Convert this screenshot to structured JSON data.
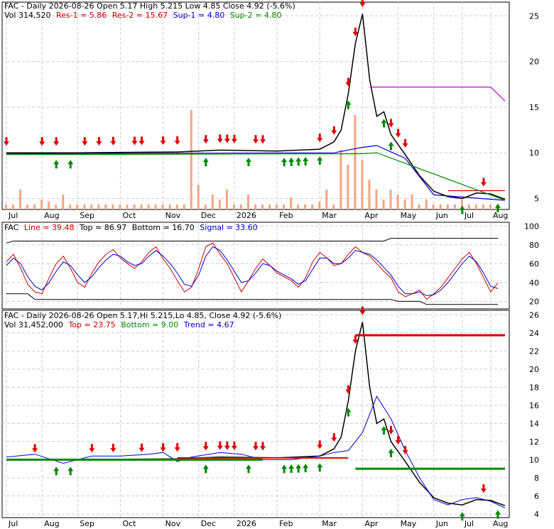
{
  "header": {
    "panel1_line1": "FAC - Daily 2026-08-26 Open 5.17  High 5.215  Low 4.85  Close 4.92 (-5.6%)",
    "panel1_line2_vol": "Vol 314,520",
    "panel1_res1": "Res-1 = 5.86",
    "panel1_res2": "Res-2 = 15.67",
    "panel1_sup1": "Sup-1 = 4.80",
    "panel1_sup2": "Sup-2 = 4.80",
    "panel2_symbol": "FAC",
    "panel2_line": "Line = 39.48",
    "panel2_top": "Top = 86.97",
    "panel2_bottom": "Bottom = 16.70",
    "panel2_signal": "Signal = 33.60",
    "panel3_line1": "FAC - Daily 2026-08-26 Open 5.17,Hi 5.215,Lo 4.85, Close 4.92 (-5.6%)",
    "panel3_line2_vol": "Vol 31,452,000",
    "panel3_top": "Top = 23.75",
    "panel3_bottom": "Bottom = 9.00",
    "panel3_trend": "Trend = 4.67"
  },
  "colors": {
    "res1": "#cc0000",
    "res2": "#cc0000",
    "sup1": "#0000cc",
    "sup2": "#008800",
    "volume": "#f4a582",
    "price": "#000000",
    "ma_blue": "#0000cc",
    "ma_magenta": "#cc00cc",
    "line_red": "#cc0000",
    "signal_blue": "#0000cc",
    "trend_green": "#008800",
    "top_red": "#dd0000",
    "up_arrow": "#008800",
    "down_arrow": "#dd0000"
  },
  "chart_data": [
    {
      "type": "line",
      "panel": "price-with-support-resistance",
      "x_labels": [
        "Jul",
        "Aug",
        "Sep",
        "Oct",
        "Nov",
        "Dec",
        "2026",
        "Feb",
        "Mar",
        "Apr",
        "May",
        "Jun",
        "Jul",
        "Aug"
      ],
      "y_ticks": [
        5,
        10,
        15,
        20,
        25
      ],
      "ylim": [
        3.8,
        26.5
      ],
      "series": [
        {
          "name": "Close",
          "points": [
            [
              0,
              10
            ],
            [
              10,
              10
            ],
            [
              24,
              10.1
            ],
            [
              30,
              10.3
            ],
            [
              38,
              10.2
            ],
            [
              44,
              10.4
            ],
            [
              46,
              11.2
            ],
            [
              47,
              12.5
            ],
            [
              48,
              16.5
            ],
            [
              49,
              22
            ],
            [
              50,
              25.2
            ],
            [
              51,
              18
            ],
            [
              52,
              14
            ],
            [
              53,
              14.5
            ],
            [
              54,
              12
            ],
            [
              56,
              9.8
            ],
            [
              58,
              7.5
            ],
            [
              60,
              5.8
            ],
            [
              62,
              5.2
            ],
            [
              64,
              5.0
            ],
            [
              66,
              5.6
            ],
            [
              68,
              5.5
            ],
            [
              70,
              4.92
            ]
          ]
        },
        {
          "name": "Res-1",
          "points": [
            [
              62,
              5.86
            ],
            [
              70,
              5.86
            ]
          ]
        },
        {
          "name": "Res-2",
          "points": [
            [
              51,
              17.2
            ],
            [
              68,
              17.2
            ],
            [
              70,
              15.67
            ]
          ]
        },
        {
          "name": "Sup-1",
          "points": [
            [
              0,
              9.9
            ],
            [
              46,
              10
            ],
            [
              50,
              10.6
            ],
            [
              52,
              10.8
            ],
            [
              56,
              9.4
            ],
            [
              60,
              5.4
            ],
            [
              70,
              4.8
            ]
          ]
        },
        {
          "name": "Sup-2",
          "points": [
            [
              0,
              9.8
            ],
            [
              50,
              9.9
            ],
            [
              52,
              10
            ],
            [
              70,
              4.8
            ]
          ]
        }
      ],
      "volume": [
        0.05,
        0.05,
        0.2,
        0.05,
        0.05,
        0.1,
        0.08,
        0.05,
        0.15,
        0.05,
        0.05,
        0.05,
        0.05,
        0.05,
        0.05,
        0.05,
        0.05,
        0.05,
        0.05,
        0.05,
        0.05,
        0.05,
        0.05,
        0.05,
        0.05,
        0.05,
        1.0,
        0.25,
        0.05,
        0.15,
        0.1,
        0.2,
        0.05,
        0.05,
        0.15,
        0.05,
        0.05,
        0.05,
        0.05,
        0.05,
        0.12,
        0.05,
        0.05,
        0.05,
        0.08,
        0.2,
        0.05,
        0.6,
        0.45,
        0.95,
        0.5,
        0.3,
        0.2,
        0.1,
        0.2,
        0.15,
        0.1,
        0.15,
        0.05,
        0.1,
        0.05,
        0.05,
        0.05,
        0.05,
        0.1,
        0.05,
        0.05,
        0.05,
        0.05,
        0.05
      ],
      "up_arrows_x": [
        7,
        9,
        28,
        34,
        39,
        40,
        41,
        42,
        44,
        48,
        53,
        54,
        64,
        69
      ],
      "down_arrows_x": [
        0,
        5,
        7,
        11,
        13,
        15,
        18,
        19,
        22,
        24,
        28,
        30,
        31,
        32,
        35,
        36,
        44,
        46,
        48,
        49,
        50,
        54,
        55,
        56,
        67
      ]
    },
    {
      "type": "line",
      "panel": "oscillator",
      "y_ticks": [
        20,
        40,
        60,
        80,
        100
      ],
      "ylim": [
        12,
        104
      ],
      "series": [
        {
          "name": "Line",
          "values": [
            62,
            70,
            55,
            38,
            30,
            28,
            45,
            60,
            68,
            55,
            40,
            35,
            50,
            62,
            70,
            75,
            66,
            60,
            55,
            62,
            72,
            78,
            65,
            55,
            42,
            30,
            35,
            55,
            78,
            82,
            70,
            60,
            45,
            30,
            42,
            55,
            65,
            58,
            50,
            46,
            42,
            35,
            45,
            62,
            72,
            66,
            58,
            60,
            70,
            78,
            72,
            68,
            60,
            52,
            45,
            30,
            25,
            28,
            32,
            22,
            28,
            35,
            45,
            55,
            65,
            72,
            60,
            45,
            30,
            39.48
          ]
        },
        {
          "name": "Signal",
          "values": [
            58,
            66,
            60,
            46,
            36,
            32,
            40,
            52,
            62,
            58,
            48,
            40,
            46,
            56,
            64,
            70,
            68,
            62,
            58,
            60,
            68,
            74,
            68,
            60,
            50,
            38,
            36,
            48,
            68,
            78,
            74,
            64,
            52,
            40,
            42,
            50,
            60,
            58,
            52,
            48,
            44,
            38,
            42,
            54,
            66,
            66,
            60,
            60,
            66,
            74,
            72,
            70,
            64,
            56,
            48,
            36,
            28,
            28,
            30,
            26,
            27,
            32,
            40,
            50,
            60,
            68,
            62,
            50,
            36,
            33.6
          ]
        },
        {
          "name": "Top",
          "values": [
            82,
            84,
            84,
            84,
            84,
            84,
            84,
            84,
            84,
            84,
            84,
            84,
            84,
            84,
            84,
            84,
            84,
            84,
            84,
            84,
            84,
            84,
            84,
            84,
            84,
            84,
            84,
            84,
            84,
            84,
            84,
            84,
            84,
            84,
            84,
            84,
            84,
            84,
            84,
            84,
            84,
            84,
            84,
            84,
            84,
            84,
            84,
            84,
            84,
            84,
            84,
            84,
            84,
            84,
            86.97,
            86.97,
            86.97,
            86.97,
            86.97,
            86.97,
            86.97,
            86.97,
            86.97,
            86.97,
            86.97,
            86.97,
            86.97,
            86.97,
            86.97,
            86.97
          ]
        },
        {
          "name": "Bottom",
          "values": [
            28,
            28,
            28,
            28,
            22,
            22,
            22,
            22,
            22,
            22,
            22,
            22,
            22,
            22,
            22,
            22,
            22,
            22,
            22,
            22,
            22,
            22,
            22,
            22,
            22,
            22,
            22,
            22,
            22,
            22,
            22,
            22,
            22,
            22,
            22,
            22,
            22,
            22,
            22,
            22,
            22,
            22,
            22,
            22,
            22,
            22,
            22,
            22,
            22,
            22,
            22,
            22,
            22,
            22,
            22,
            20,
            20,
            20,
            20,
            16.7,
            16.7,
            16.7,
            16.7,
            16.7,
            16.7,
            16.7,
            16.7,
            16.7,
            16.7,
            16.7
          ]
        }
      ]
    },
    {
      "type": "line",
      "panel": "trend",
      "x_labels": [
        "Jul",
        "Aug",
        "Sep",
        "Oct",
        "Nov",
        "Dec",
        "2026",
        "Feb",
        "Mar",
        "Apr",
        "May",
        "Jun",
        "Jul",
        "Aug"
      ],
      "y_ticks": [
        4,
        6,
        8,
        10,
        12,
        14,
        16,
        18,
        20,
        22,
        24,
        26
      ],
      "ylim": [
        3.6,
        26.5
      ],
      "series": [
        {
          "name": "Close",
          "points": [
            [
              0,
              10
            ],
            [
              10,
              10
            ],
            [
              24,
              10.1
            ],
            [
              30,
              10.3
            ],
            [
              38,
              10.2
            ],
            [
              44,
              10.4
            ],
            [
              46,
              11.2
            ],
            [
              47,
              12.5
            ],
            [
              48,
              16.5
            ],
            [
              49,
              22
            ],
            [
              50,
              25.2
            ],
            [
              51,
              18
            ],
            [
              52,
              14
            ],
            [
              53,
              14.5
            ],
            [
              54,
              12
            ],
            [
              56,
              9.8
            ],
            [
              58,
              7.5
            ],
            [
              60,
              5.8
            ],
            [
              62,
              5.2
            ],
            [
              64,
              5.0
            ],
            [
              66,
              5.6
            ],
            [
              68,
              5.5
            ],
            [
              70,
              4.92
            ]
          ]
        },
        {
          "name": "Trend",
          "points": [
            [
              0,
              10.3
            ],
            [
              4,
              10.6
            ],
            [
              8,
              9.6
            ],
            [
              12,
              10.4
            ],
            [
              16,
              10.4
            ],
            [
              20,
              10.6
            ],
            [
              22,
              10.8
            ],
            [
              24,
              9.8
            ],
            [
              26,
              10.3
            ],
            [
              30,
              10.8
            ],
            [
              33,
              10.6
            ],
            [
              36,
              10
            ],
            [
              40,
              10
            ],
            [
              44,
              10.4
            ],
            [
              46,
              10.8
            ],
            [
              48,
              11
            ],
            [
              50,
              13
            ],
            [
              52,
              17
            ],
            [
              54,
              14.5
            ],
            [
              56,
              11
            ],
            [
              58,
              8
            ],
            [
              60,
              5.6
            ],
            [
              62,
              5
            ],
            [
              64,
              5.6
            ],
            [
              66,
              5.8
            ],
            [
              68,
              5.4
            ],
            [
              70,
              4.67
            ]
          ]
        },
        {
          "name": "Top",
          "points": [
            [
              49,
              23.75
            ],
            [
              70,
              23.75
            ]
          ]
        },
        {
          "name": "Bottom",
          "points": [
            [
              49,
              9.0
            ],
            [
              70,
              9.0
            ]
          ]
        }
      ],
      "up_arrows_x": [
        7,
        9,
        28,
        34,
        39,
        40,
        41,
        42,
        44,
        48,
        53,
        54,
        64,
        69
      ],
      "down_arrows_x": [
        4,
        12,
        15,
        19,
        22,
        24,
        28,
        30,
        31,
        32,
        35,
        36,
        44,
        46,
        48,
        49,
        50,
        54,
        55,
        56,
        67
      ]
    }
  ]
}
